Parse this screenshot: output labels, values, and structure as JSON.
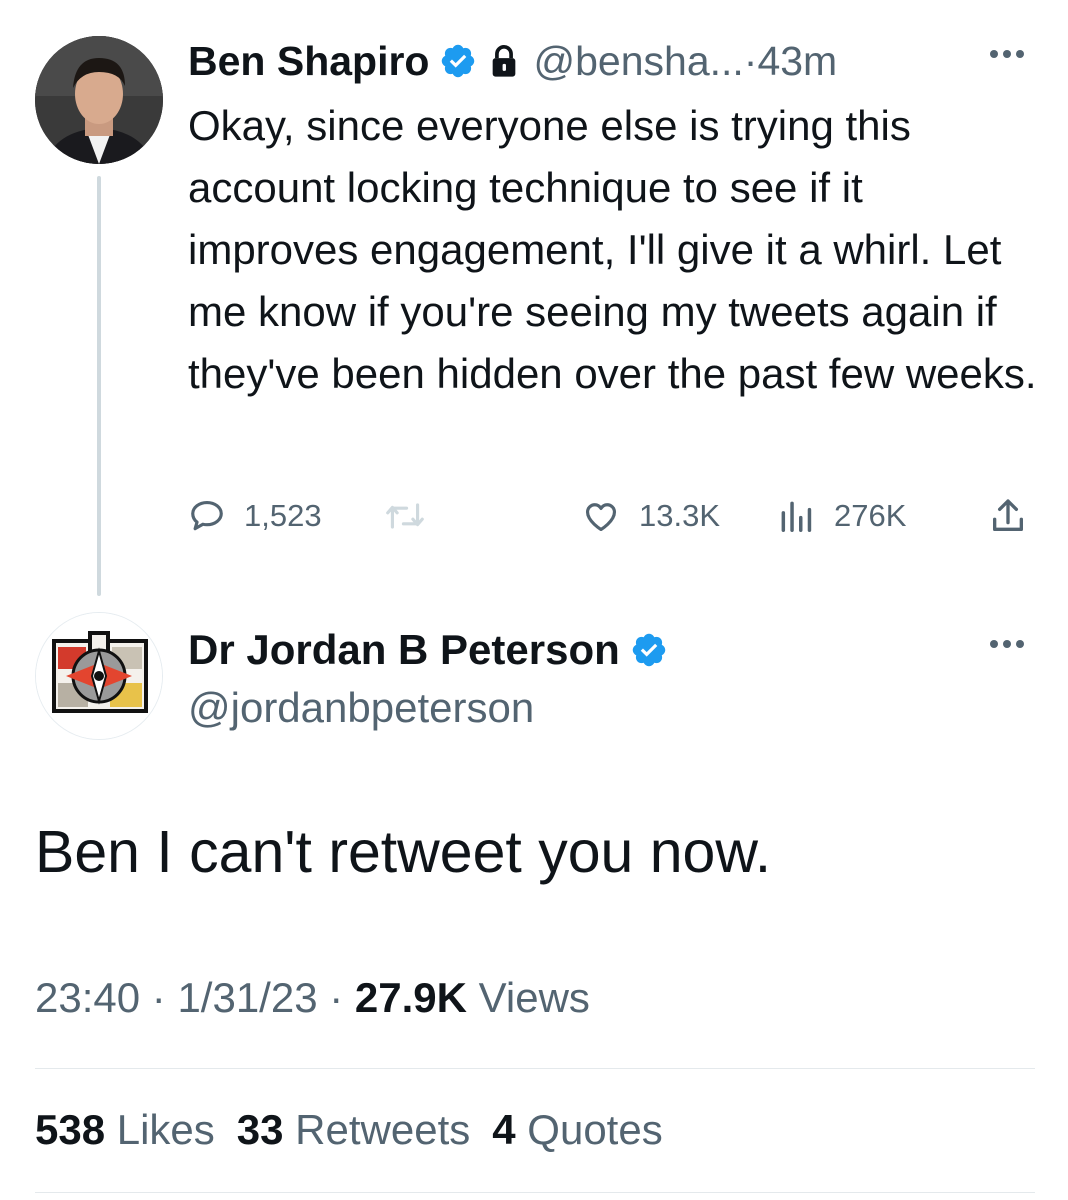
{
  "parent_tweet": {
    "author_name": "Ben Shapiro",
    "handle": "@bensha...",
    "separator": " · ",
    "time_ago": "43m",
    "text": "Okay, since everyone else is trying this account locking technique to see if it improves engagement, I'll give it a whirl. Let me know if you're seeing my tweets again if they've been hidden over the past few weeks.",
    "replies": "1,523",
    "likes": "13.3K",
    "views": "276K",
    "icons": [
      "verified-icon",
      "lock-icon",
      "more-icon",
      "reply-icon",
      "retweet-icon",
      "like-icon",
      "views-icon",
      "share-icon"
    ]
  },
  "reply_tweet": {
    "author_name": "Dr Jordan B Peterson",
    "handle": "@jordanbpeterson",
    "text": "Ben I can't retweet you now.",
    "time": "23:40",
    "dot": " · ",
    "date": "1/31/23",
    "views_count": "27.9K",
    "views_label": " Views",
    "likes_count": "538",
    "likes_label": " Likes",
    "retweets_count": "33",
    "retweets_label": " Retweets",
    "quotes_count": "4",
    "quotes_label": " Quotes"
  },
  "colors": {
    "text": "#0f1419",
    "muted": "#536471",
    "verified": "#1d9bf0",
    "retweet_disabled": "#cfd9de",
    "divider": "#e4e9ec"
  }
}
